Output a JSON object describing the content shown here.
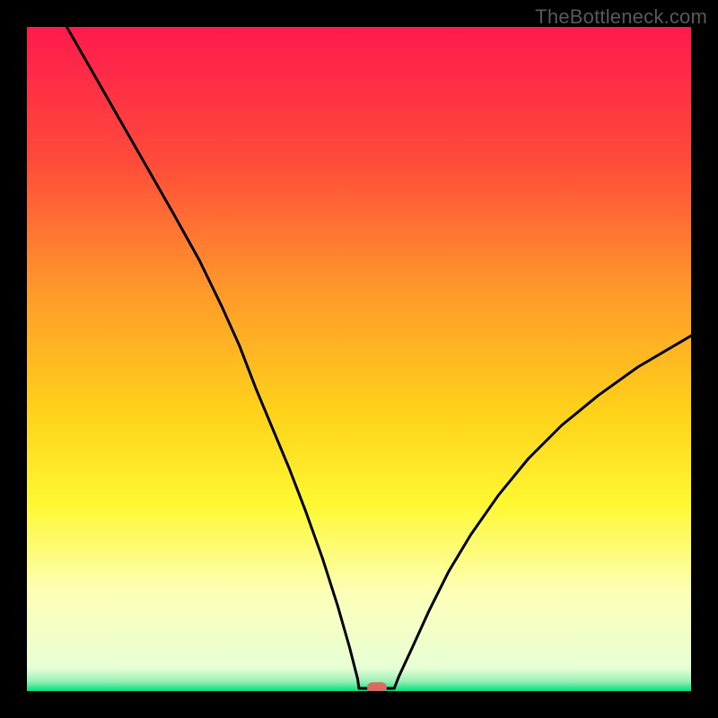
{
  "watermark": "TheBottleneck.com",
  "chart_data": {
    "type": "line",
    "title": "",
    "xlabel": "",
    "ylabel": "",
    "xlim": [
      0.0,
      1.0
    ],
    "ylim": [
      0.0,
      1.0
    ],
    "gradient_stops": [
      {
        "offset": 0.0,
        "color": "#ff1a4d"
      },
      {
        "offset": 0.2,
        "color": "#ff4a3a"
      },
      {
        "offset": 0.4,
        "color": "#ff9a2a"
      },
      {
        "offset": 0.58,
        "color": "#ffd21a"
      },
      {
        "offset": 0.72,
        "color": "#fff833"
      },
      {
        "offset": 0.85,
        "color": "#fdffb6"
      },
      {
        "offset": 0.965,
        "color": "#e8ffd6"
      },
      {
        "offset": 0.985,
        "color": "#9cf0b7"
      },
      {
        "offset": 1.0,
        "color": "#00e07a"
      }
    ],
    "marker": {
      "x": 0.527,
      "y": 0.005,
      "color": "#d86b5f"
    },
    "series": [
      {
        "name": "curve",
        "points": [
          {
            "x": 0.06,
            "y": 1.0
          },
          {
            "x": 0.1,
            "y": 0.93
          },
          {
            "x": 0.14,
            "y": 0.86
          },
          {
            "x": 0.18,
            "y": 0.79
          },
          {
            "x": 0.22,
            "y": 0.72
          },
          {
            "x": 0.26,
            "y": 0.648
          },
          {
            "x": 0.293,
            "y": 0.58
          },
          {
            "x": 0.32,
            "y": 0.52
          },
          {
            "x": 0.345,
            "y": 0.455
          },
          {
            "x": 0.37,
            "y": 0.395
          },
          {
            "x": 0.395,
            "y": 0.335
          },
          {
            "x": 0.42,
            "y": 0.27
          },
          {
            "x": 0.445,
            "y": 0.2
          },
          {
            "x": 0.468,
            "y": 0.128
          },
          {
            "x": 0.486,
            "y": 0.065
          },
          {
            "x": 0.498,
            "y": 0.018
          },
          {
            "x": 0.5,
            "y": 0.004
          },
          {
            "x": 0.553,
            "y": 0.004
          },
          {
            "x": 0.56,
            "y": 0.022
          },
          {
            "x": 0.58,
            "y": 0.065
          },
          {
            "x": 0.605,
            "y": 0.12
          },
          {
            "x": 0.635,
            "y": 0.18
          },
          {
            "x": 0.668,
            "y": 0.235
          },
          {
            "x": 0.71,
            "y": 0.295
          },
          {
            "x": 0.755,
            "y": 0.35
          },
          {
            "x": 0.805,
            "y": 0.4
          },
          {
            "x": 0.86,
            "y": 0.445
          },
          {
            "x": 0.92,
            "y": 0.488
          },
          {
            "x": 0.978,
            "y": 0.522
          },
          {
            "x": 1.0,
            "y": 0.535
          }
        ]
      }
    ]
  }
}
